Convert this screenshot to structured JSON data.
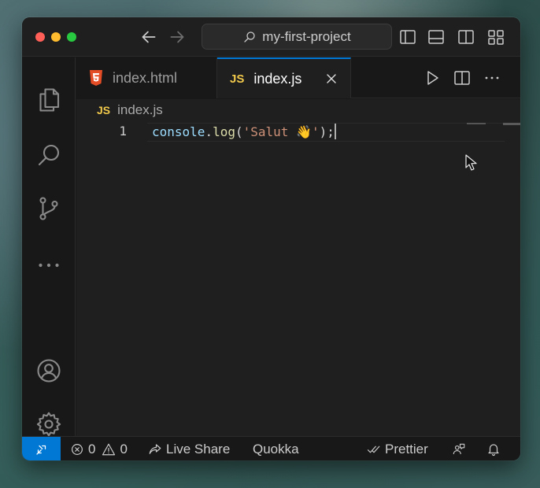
{
  "titlebar": {
    "search_label": "my-first-project",
    "icons": [
      "arrow-left-icon",
      "arrow-right-icon",
      "search-icon",
      "toggle-primary-sidebar-icon",
      "toggle-panel-icon",
      "toggle-secondary-sidebar-icon",
      "customize-layout-icon"
    ]
  },
  "activity_bar": {
    "items": [
      "explorer-icon",
      "search-icon",
      "source-control-icon",
      "more-icon",
      "account-icon",
      "settings-gear-icon"
    ]
  },
  "tabs": [
    {
      "label": "index.html",
      "icon": "html5-icon",
      "active": false
    },
    {
      "label": "index.js",
      "badge": "JS",
      "active": true
    }
  ],
  "editor_actions": [
    "run-icon",
    "split-editor-icon",
    "more-actions-icon"
  ],
  "breadcrumb": {
    "badge": "JS",
    "file": "index.js"
  },
  "editor": {
    "line_number": "1",
    "code": {
      "object": "console",
      "dot": ".",
      "method": "log",
      "open": "(",
      "string": "'Salut 👋'",
      "close": ");"
    }
  },
  "statusbar": {
    "remote_icon": "remote-indicator-icon",
    "errors": "0",
    "warnings": "0",
    "live_share": "Live Share",
    "quokka": "Quokka",
    "prettier": "Prettier",
    "accent": "#0078d4"
  },
  "colors": {
    "js_badge": "#f1c94b",
    "html_icon": "#e44d26",
    "window_bg": "#181818",
    "editor_bg": "#1f1f1f"
  }
}
